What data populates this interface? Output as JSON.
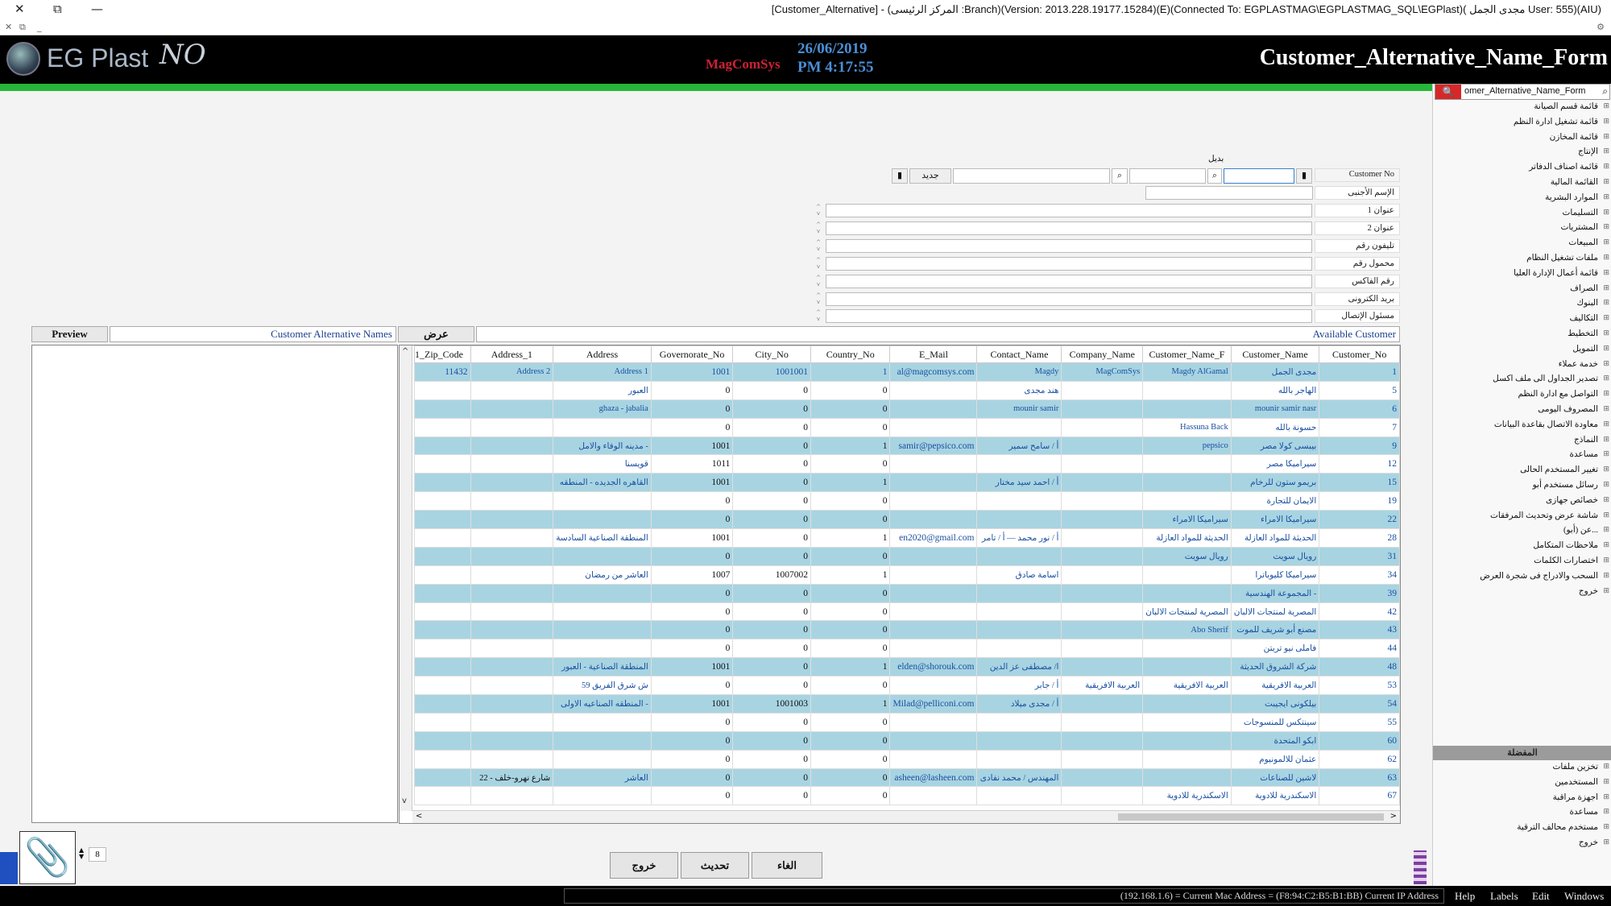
{
  "window": {
    "title": "[Customer_Alternative] - (المركز الرئيسى :Branch)(Version: 2013.228.19177.15284)(E)(Connected To: EGPLASTMAG\\EGPLASTMAG_SQL\\EGPlast)( مجدى الجمل User: 555)(AIU)",
    "close": "✕",
    "restore": "⧉",
    "minimize": "—"
  },
  "header": {
    "logo_text": "EG Plast",
    "logo_signature": "NO",
    "brand": "MagComSys",
    "date": "26/06/2019",
    "time": "PM 4:17:55",
    "form_title": "Customer_Alternative_Name_Form"
  },
  "sidebar": {
    "search_value": "omer_Alternative_Name_Form",
    "menu": [
      "قائمة قسم الصيانة",
      "قائمة تشغيل ادارة النظم",
      "قائمة المخازن",
      "الإنتاج",
      "قائمة اصناف الدفاتر",
      "القائمة المالية",
      "الموارد البشرية",
      "التسليمات",
      "المشتريات",
      "المبيعات",
      "ملفات تشغيل النظام",
      "قائمة أعمال الإدارة العليا",
      "الصراف",
      "البنوك",
      "التكاليف",
      "التخطيط",
      "التمويل",
      "خدمة عملاء",
      "تصدير الجداول الى ملف اكسل",
      "التواصل مع ادارة النظم",
      "المصروف اليومى",
      "معاودة الاتصال بقاعدة البيانات",
      "النماذج",
      "مساعدة",
      "تغيير المستخدم الحالى",
      "رسائل مستخدم أبو",
      "خصائص جهازى",
      "شاشة عرض وتحديث المرفقات",
      "عن (أبو)...",
      "ملاحظات المتكامل",
      "اختصارات الكلمات",
      "السحب والادراج فى شجرة العرض",
      "خروج"
    ],
    "fav_header": "المفضلة",
    "fav_menu": [
      "تخزين ملفات",
      "المستخدمين",
      "اجهزة مراقبة",
      "مساعدة",
      "مستخدم محالف الترقية",
      "خروج"
    ]
  },
  "form": {
    "alt_label": "بديل",
    "new_button": "جديد",
    "fields": [
      "Customer No",
      "الإسم الأجنبى",
      "عنوان 1",
      "عنوان 2",
      "تليفون رقم",
      "محمول رقم",
      "رقم الفاكس",
      "بريد الكترونى",
      "مسئول الإتصال"
    ]
  },
  "tabs": {
    "preview": "Preview",
    "alt_names": "Customer Alternative Names",
    "show": "عرض",
    "available": "Available Customer"
  },
  "grid": {
    "columns": [
      "1_Zip_Code",
      "Address_1",
      "Address",
      "Governorate_No",
      "City_No",
      "Country_No",
      "E_Mail",
      "Contact_Name",
      "Company_Name",
      "Customer_Name_F",
      "Customer_Name",
      "Customer_No"
    ],
    "rows": [
      [
        "11432",
        "Address 2",
        "Address 1",
        "1001",
        "1001001",
        "1",
        "al@magcomsys.com",
        "Magdy",
        "MagComSys",
        "Magdy AlGamal",
        "مجدى الجمل",
        "1"
      ],
      [
        "",
        "",
        "العبور",
        "0",
        "0",
        "0",
        "",
        "هند مجدى",
        "",
        "",
        "الهاجر بالله",
        "5"
      ],
      [
        "",
        "",
        "ghaza - jabalia",
        "0",
        "0",
        "0",
        "",
        "mounir samir",
        "",
        "",
        "mounir samir nasr",
        "6"
      ],
      [
        "",
        "",
        "",
        "0",
        "0",
        "0",
        "",
        "",
        "",
        "Hassuna Back",
        "حسونة بالله",
        "7"
      ],
      [
        "",
        "",
        "مدينه الوفاء والامل -",
        "1001",
        "0",
        "1",
        "samir@pepsico.com",
        "أ / سامح سمير",
        "",
        "pepsico",
        "بيبسى كولا مصر",
        "9"
      ],
      [
        "",
        "",
        "قويسنا",
        "1011",
        "0",
        "0",
        "",
        "",
        "",
        "",
        "سيراميكا مصر",
        "12"
      ],
      [
        "",
        "",
        "القاهره الجديده - المنطقه",
        "1001",
        "0",
        "1",
        "",
        "أ / احمد سيد مختار",
        "",
        "",
        "بريمو ستون للرخام",
        "15"
      ],
      [
        "",
        "",
        "",
        "0",
        "0",
        "0",
        "",
        "",
        "",
        "",
        "الايمان للتجارة",
        "19"
      ],
      [
        "",
        "",
        "",
        "0",
        "0",
        "0",
        "",
        "",
        "",
        "سيراميكا الامراء",
        "سيراميكا الامراء",
        "22"
      ],
      [
        "",
        "",
        "المنطقة الصناعية السادسة",
        "1001",
        "0",
        "1",
        "en2020@gmail.com",
        "أ / نور محمد — أ / تامر",
        "",
        "الحديثة للمواد العازلة",
        "الحديثة للمواد العازلة",
        "28"
      ],
      [
        "",
        "",
        "",
        "0",
        "0",
        "0",
        "",
        "",
        "",
        "رويال سويت",
        "رويال سويت",
        "31"
      ],
      [
        "",
        "",
        "العاشر من رمضان",
        "1007",
        "1007002",
        "1",
        "",
        "اسامة صادق",
        "",
        "",
        "سيراميكا كليوباترا",
        "34"
      ],
      [
        "",
        "",
        "",
        "0",
        "0",
        "0",
        "",
        "",
        "",
        "",
        "المجموعة الهندسية -",
        "39"
      ],
      [
        "",
        "",
        "",
        "0",
        "0",
        "0",
        "",
        "",
        "",
        "المصرية لمنتجات الالبان",
        "المصرية لمنتجات الالبان",
        "42"
      ],
      [
        "",
        "",
        "",
        "0",
        "0",
        "0",
        "",
        "",
        "",
        "Abo Sherif",
        "مصنع أبو شريف للموت",
        "43"
      ],
      [
        "",
        "",
        "",
        "0",
        "0",
        "0",
        "",
        "",
        "",
        "",
        "فاملى نيو تريتن",
        "44"
      ],
      [
        "",
        "",
        "المنطقة الصناعية - العبور",
        "1001",
        "0",
        "1",
        "elden@shorouk.com",
        "ا/ مصطفى عز الدين",
        "",
        "",
        "شركة الشروق الحديثة",
        "48"
      ],
      [
        "",
        "",
        "59 ش شرق الفريق",
        "0",
        "0",
        "0",
        "",
        "أ / جابر",
        "العربية الافريقية",
        "العربية الافريقية",
        "العربية الافريقية",
        "53"
      ],
      [
        "",
        "",
        "المنطقه الصناعيه الاولى -",
        "1001",
        "1001003",
        "1",
        "Milad@pelliconi.com",
        "أ / مجدى ميلاد",
        "",
        "",
        "بيلكونى ايجيبت",
        "54"
      ],
      [
        "",
        "",
        "",
        "0",
        "0",
        "0",
        "",
        "",
        "",
        "",
        "سينتكس للمنسوجات",
        "55"
      ],
      [
        "",
        "",
        "",
        "0",
        "0",
        "0",
        "",
        "",
        "",
        "",
        "ابكو المتحدة",
        "60"
      ],
      [
        "",
        "",
        "",
        "0",
        "0",
        "0",
        "",
        "",
        "",
        "",
        "عثمان للالمونيوم",
        "62"
      ],
      [
        "",
        "22 - شارع نهرو-خلف",
        "العاشر",
        "0",
        "0",
        "0",
        "asheen@lasheen.com",
        "المهندس / محمد نفادى",
        "",
        "",
        "لاشين للصناعات",
        "63"
      ],
      [
        "",
        "",
        "",
        "0",
        "0",
        "0",
        "",
        "",
        "",
        "الاسكندرية للادوية",
        "الاسكندرية للادوية",
        "67"
      ]
    ]
  },
  "bottom": {
    "exit": "خروج",
    "refresh": "تحديث",
    "cancel": "الغاء",
    "page": "8"
  },
  "status": {
    "text": "(192.168.1.6) = Current Mac Address = (F8:94:C2:B5:B1:BB) Current IP Address",
    "help": "Help",
    "labels": "Labels",
    "edit": "Edit",
    "windows": "Windows"
  }
}
